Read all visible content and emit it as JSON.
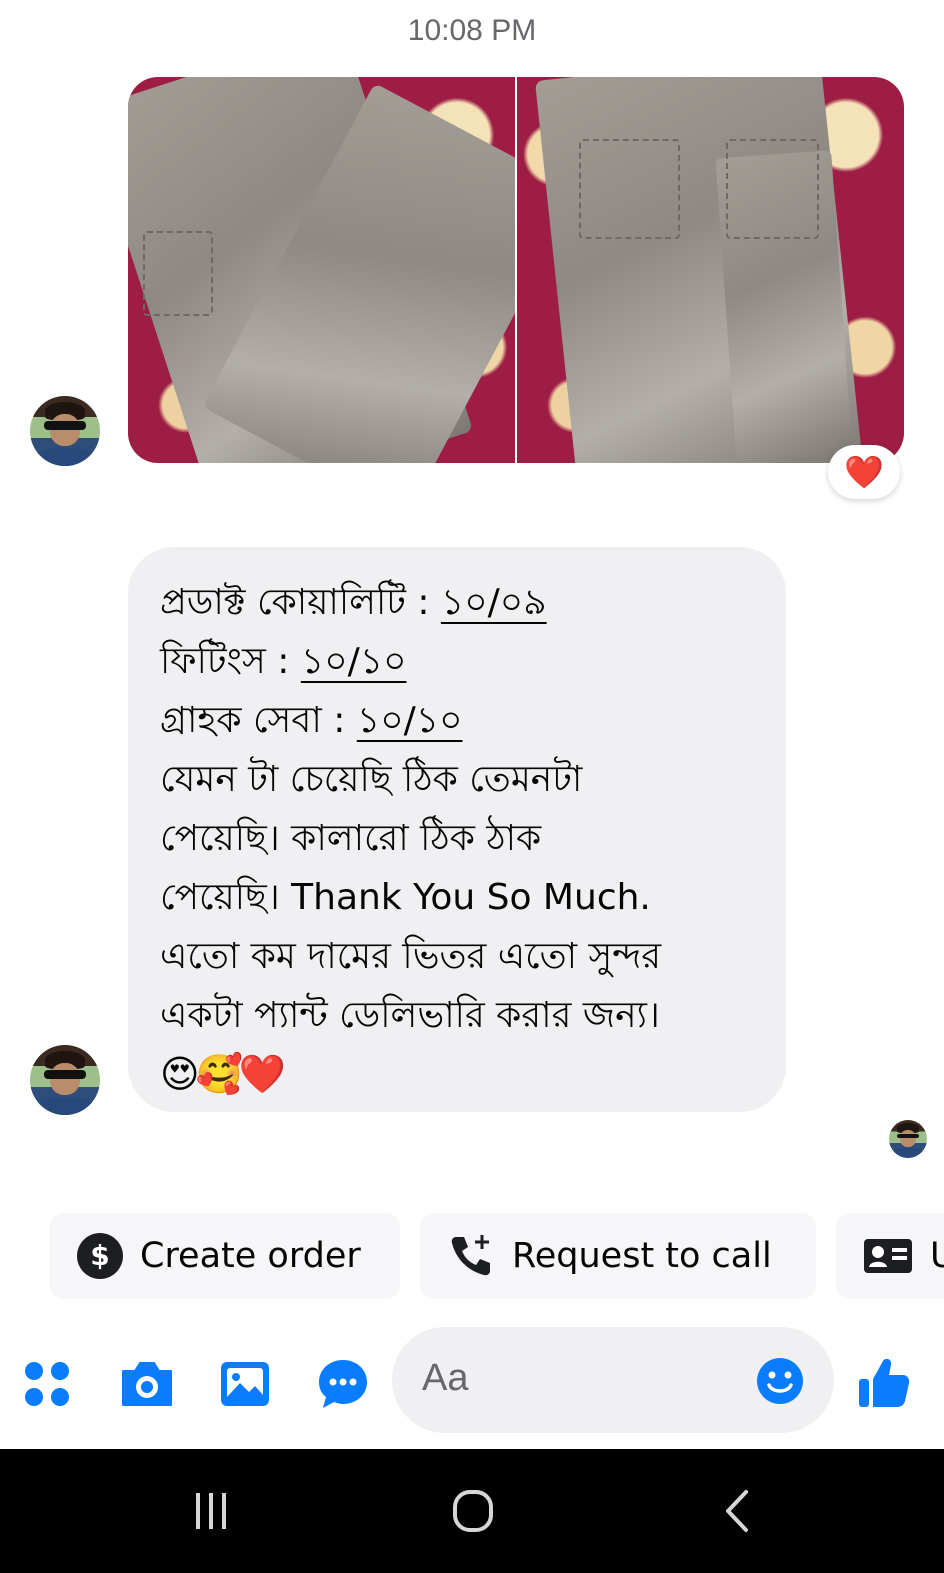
{
  "chat": {
    "timestamp": "10:08 PM",
    "photo_reaction": "❤️",
    "message_lines": [
      {
        "text": "প্রডাক্ট কোয়ালিটি : ",
        "underlined": "১০/০৯"
      },
      {
        "text": "ফিটিংস : ",
        "underlined": "১০/১০"
      },
      {
        "text": "গ্রাহক সেবা : ",
        "underlined": "১০/১০"
      },
      {
        "text": "যেমন টা চেয়েছি ঠিক তেমনটা",
        "underlined": ""
      },
      {
        "text": "পেয়েছি। কালারো ঠিক ঠাক",
        "underlined": ""
      },
      {
        "text": "পেয়েছি। Thank You  So Much.",
        "underlined": ""
      },
      {
        "text": "এতো কম দামের ভিতর এতো সুন্দর",
        "underlined": ""
      },
      {
        "text": "একটা প্যান্ট ডেলিভারি করার জন্য।",
        "underlined": ""
      }
    ],
    "message_emojis": "😍🥰❤️"
  },
  "quick_actions": [
    {
      "label": "Create order",
      "icon": "dollar-circle-icon"
    },
    {
      "label": "Request to call",
      "icon": "phone-add-icon"
    },
    {
      "label": "U",
      "icon": "id-card-icon"
    }
  ],
  "composer": {
    "placeholder": "Aa",
    "icons": [
      "apps-icon",
      "camera-icon",
      "gallery-icon",
      "chat-bubble-icon",
      "emoji-icon",
      "like-icon"
    ]
  },
  "colors": {
    "accent": "#0a7cff",
    "bubble": "#f0f0f3",
    "reaction": "#e41e3f"
  }
}
